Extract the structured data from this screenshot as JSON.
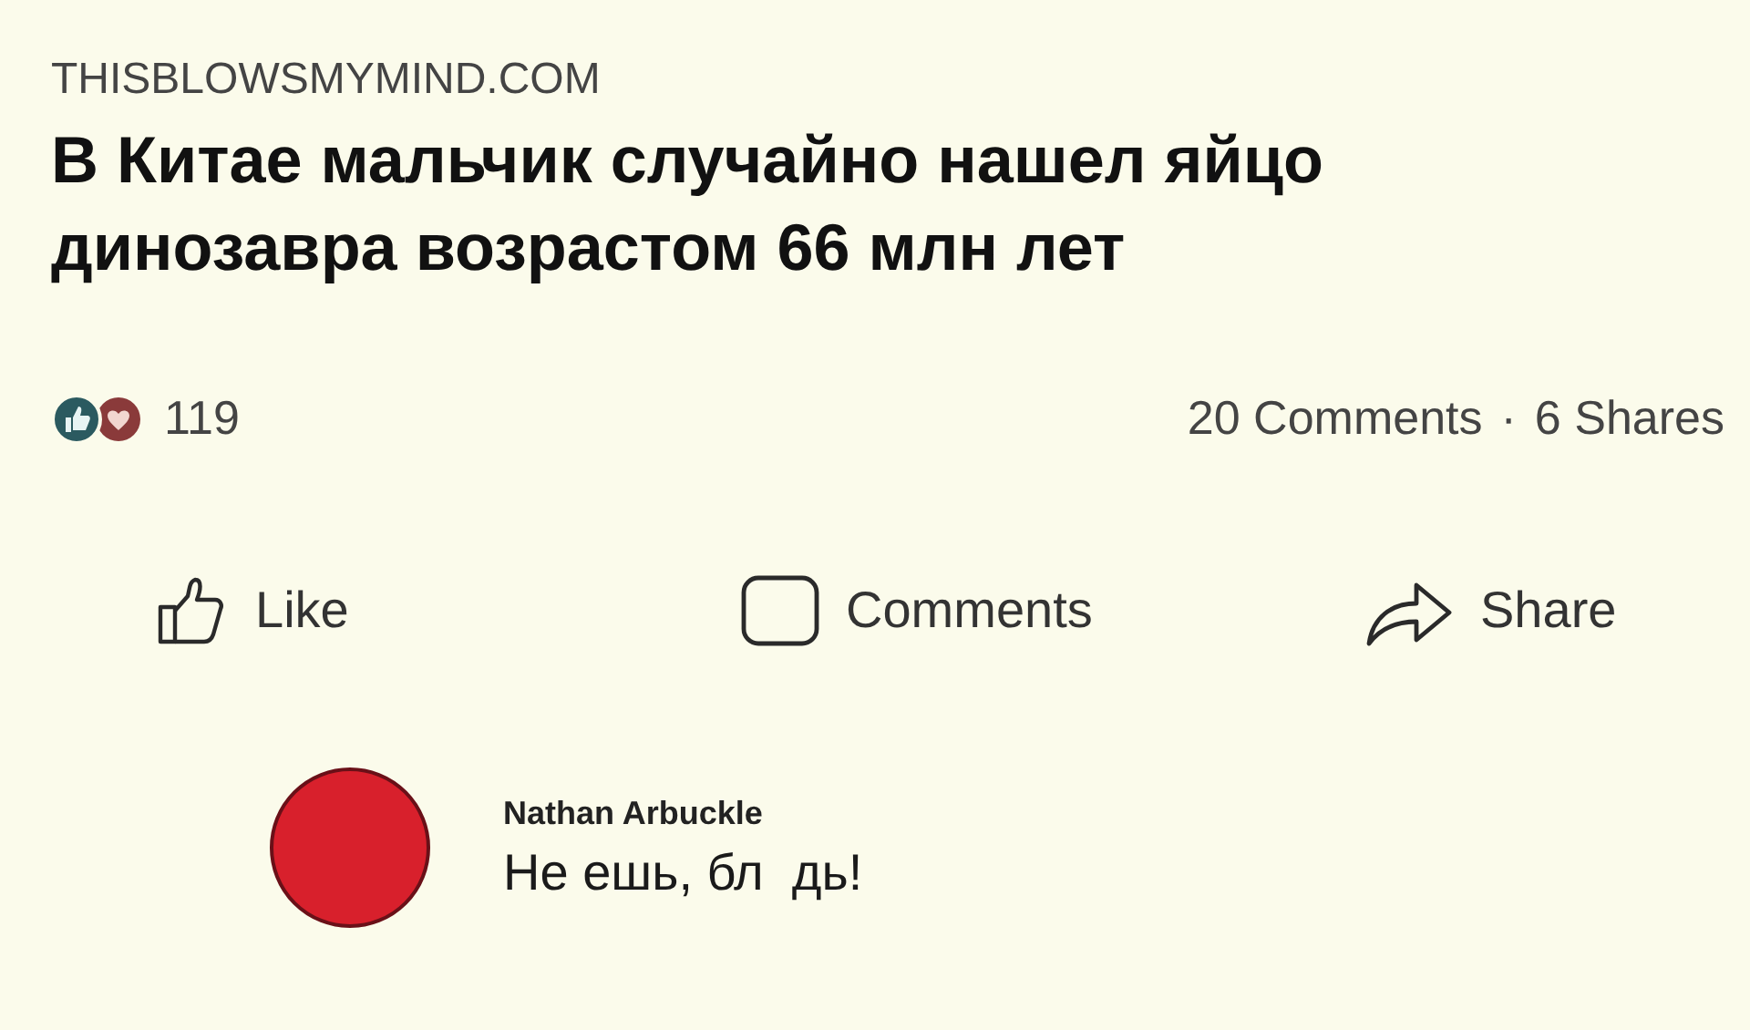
{
  "post": {
    "source": "THISBLOWSMYMIND.COM",
    "headline": "В Китае мальчик случайно нашел яйцо динозавра возрастом 66 млн лет"
  },
  "reactions": {
    "count": "119",
    "comments": "20 Comments",
    "separator": "·",
    "shares": "6 Shares"
  },
  "actions": [
    {
      "kind": "like",
      "label": "Like"
    },
    {
      "kind": "comment",
      "label": "Comments"
    },
    {
      "kind": "share",
      "label": "Share"
    }
  ],
  "comment": {
    "author": "Nathan Arbuckle",
    "text": "Не ешь, бл  дь!"
  }
}
